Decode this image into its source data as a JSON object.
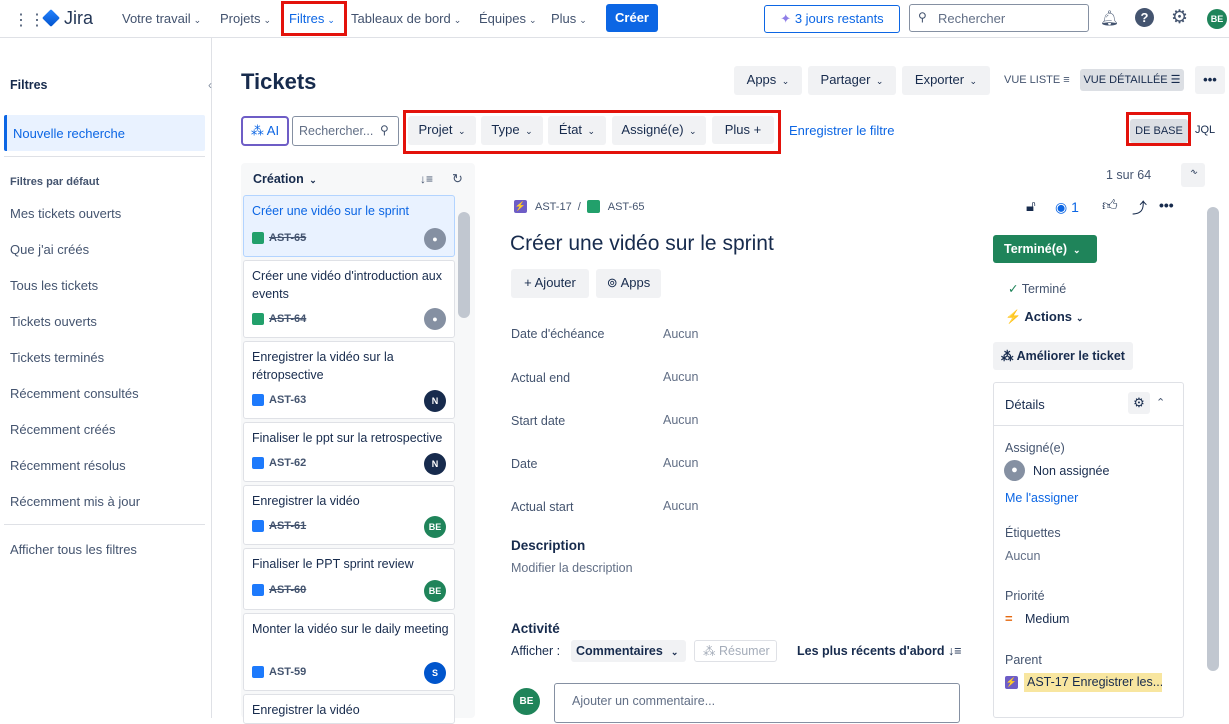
{
  "nav": {
    "brand": "Jira",
    "items": [
      "Votre travail",
      "Projets",
      "Filtres",
      "Tableaux de bord",
      "Équipes",
      "Plus"
    ],
    "create": "Créer",
    "trial": "3 jours restants",
    "search_placeholder": "Rechercher",
    "avatar": "BE"
  },
  "sidebar": {
    "title": "Filtres",
    "new_search": "Nouvelle recherche",
    "section": "Filtres par défaut",
    "items": [
      "Mes tickets ouverts",
      "Que j'ai créés",
      "Tous les tickets",
      "Tickets ouverts",
      "Tickets terminés",
      "Récemment consultés",
      "Récemment créés",
      "Récemment résolus",
      "Récemment mis à jour"
    ],
    "all_filters": "Afficher tous les filtres"
  },
  "page": {
    "title": "Tickets",
    "apps": "Apps",
    "share": "Partager",
    "export": "Exporter",
    "list_view": "VUE LISTE",
    "detail_view": "VUE DÉTAILLÉE",
    "more": "•••"
  },
  "filters": {
    "ai": "AI",
    "search_placeholder": "Rechercher...",
    "project": "Projet",
    "type": "Type",
    "state": "État",
    "assignee": "Assigné(e)",
    "more": "Plus",
    "save": "Enregistrer le filtre",
    "basic": "DE BASE",
    "jql": "JQL"
  },
  "list": {
    "sort": "Création",
    "pagination": "1 sur 64",
    "cards": [
      {
        "title": "Créer une vidéo sur le sprint",
        "key": "AST-65",
        "done": true,
        "avatar": "",
        "avcolor": "#8590a2",
        "icolor": "#22a06b"
      },
      {
        "title": "Créer une vidéo d'introduction aux events",
        "key": "AST-64",
        "done": true,
        "avatar": "",
        "avcolor": "#8590a2",
        "icolor": "#22a06b"
      },
      {
        "title": "Enregistrer la vidéo sur la rétropsective",
        "key": "AST-63",
        "done": false,
        "avatar": "N",
        "avcolor": "#172b4d",
        "icolor": "#1d7afc"
      },
      {
        "title": "Finaliser le ppt sur la retrospective",
        "key": "AST-62",
        "done": false,
        "avatar": "N",
        "avcolor": "#172b4d",
        "icolor": "#1d7afc"
      },
      {
        "title": "Enregistrer la vidéo",
        "key": "AST-61",
        "done": true,
        "avatar": "BE",
        "avcolor": "#1f845a",
        "icolor": "#1d7afc"
      },
      {
        "title": "Finaliser le PPT sprint review",
        "key": "AST-60",
        "done": true,
        "avatar": "BE",
        "avcolor": "#1f845a",
        "icolor": "#1d7afc"
      },
      {
        "title": "Monter la vidéo sur le daily meeting",
        "key": "AST-59",
        "done": false,
        "avatar": "S",
        "avcolor": "#0055cc",
        "icolor": "#1d7afc"
      },
      {
        "title": "Enregistrer la vidéo",
        "key": "",
        "done": false,
        "avatar": "",
        "avcolor": "#fff",
        "icolor": "#fff"
      }
    ]
  },
  "detail": {
    "parent_key": "AST-17",
    "key": "AST-65",
    "watchers": "1",
    "title": "Créer une vidéo sur le sprint",
    "add": "Ajouter",
    "apps": "Apps",
    "fields": [
      {
        "label": "Date d'échéance",
        "value": "Aucun"
      },
      {
        "label": "Actual end",
        "value": "Aucun"
      },
      {
        "label": "Start date",
        "value": "Aucun"
      },
      {
        "label": "Date",
        "value": "Aucun"
      },
      {
        "label": "Actual start",
        "value": "Aucun"
      }
    ],
    "description_label": "Description",
    "description_placeholder": "Modifier la description",
    "activity": "Activité",
    "show": "Afficher :",
    "comments": "Commentaires",
    "summarize": "Résumer",
    "order": "Les plus récents d'abord",
    "comment_placeholder": "Ajouter un commentaire...",
    "avatar": "BE",
    "status": "Terminé(e)",
    "resolution": "Terminé",
    "actions": "Actions",
    "improve": "Améliorer le ticket",
    "details": {
      "title": "Détails",
      "assignee_label": "Assigné(e)",
      "assignee": "Non assignée",
      "assign_me": "Me l'assigner",
      "labels_label": "Étiquettes",
      "labels": "Aucun",
      "priority_label": "Priorité",
      "priority": "Medium",
      "parent_label": "Parent",
      "parent": "AST-17 Enregistrer les..."
    }
  },
  "colors": {
    "accent": "#0c66e4",
    "highlight": "#e3120b",
    "status": "#1f845a"
  }
}
